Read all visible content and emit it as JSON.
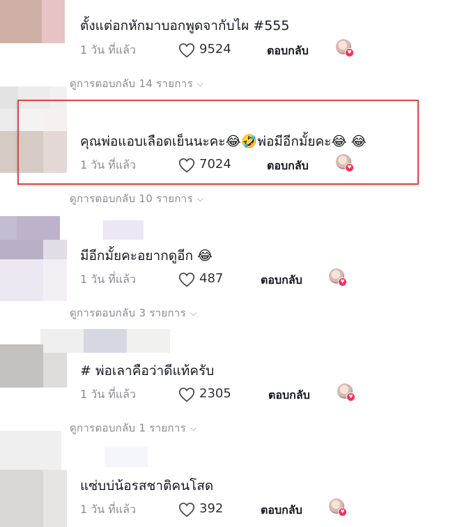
{
  "comments": [
    {
      "text": "ตั้งแต่อกหักมาบอกพูดจากับไผ #555",
      "time": "1 วัน ที่แล้ว",
      "likes": "9524",
      "reply_label": "ตอบกลับ",
      "view_replies": "ดูการตอบกลับ 14 รายการ",
      "liked_by_creator": true
    },
    {
      "text": "คุณพ่อแอบเลือดเย็นนะคะ😂🤣พ่อมีอีกมั้ยคะ😂 😂",
      "time": "1 วัน ที่แล้ว",
      "likes": "7024",
      "reply_label": "ตอบกลับ",
      "view_replies": "ดูการตอบกลับ 10 รายการ",
      "liked_by_creator": true,
      "highlighted": true
    },
    {
      "text": "มีอีกมั้ยคะอยากดูอีก 😂",
      "time": "1 วัน ที่แล้ว",
      "likes": "487",
      "reply_label": "ตอบกลับ",
      "view_replies": "ดูการตอบกลับ 3 รายการ",
      "liked_by_creator": true
    },
    {
      "text": "# พ่อเลาคือว่าดีแท้ครับ",
      "time": "1 วัน ที่แล้ว",
      "likes": "2305",
      "reply_label": "ตอบกลับ",
      "view_replies": "ดูการตอบกลับ 1 รายการ",
      "liked_by_creator": true
    },
    {
      "text": "แซ่บบ่น้อรสชาติคนโสด",
      "time": "1 วัน ที่แล้ว",
      "likes": "392",
      "reply_label": "ตอบกลับ",
      "liked_by_creator": true
    }
  ],
  "colors": {
    "highlight_border": "#d94a4a",
    "heart_badge": "#fe2c55",
    "muted_text": "#8a8b91"
  },
  "icons": [
    "heart-outline-icon",
    "chevron-down-icon",
    "creator-avatar",
    "heart-badge-icon"
  ]
}
